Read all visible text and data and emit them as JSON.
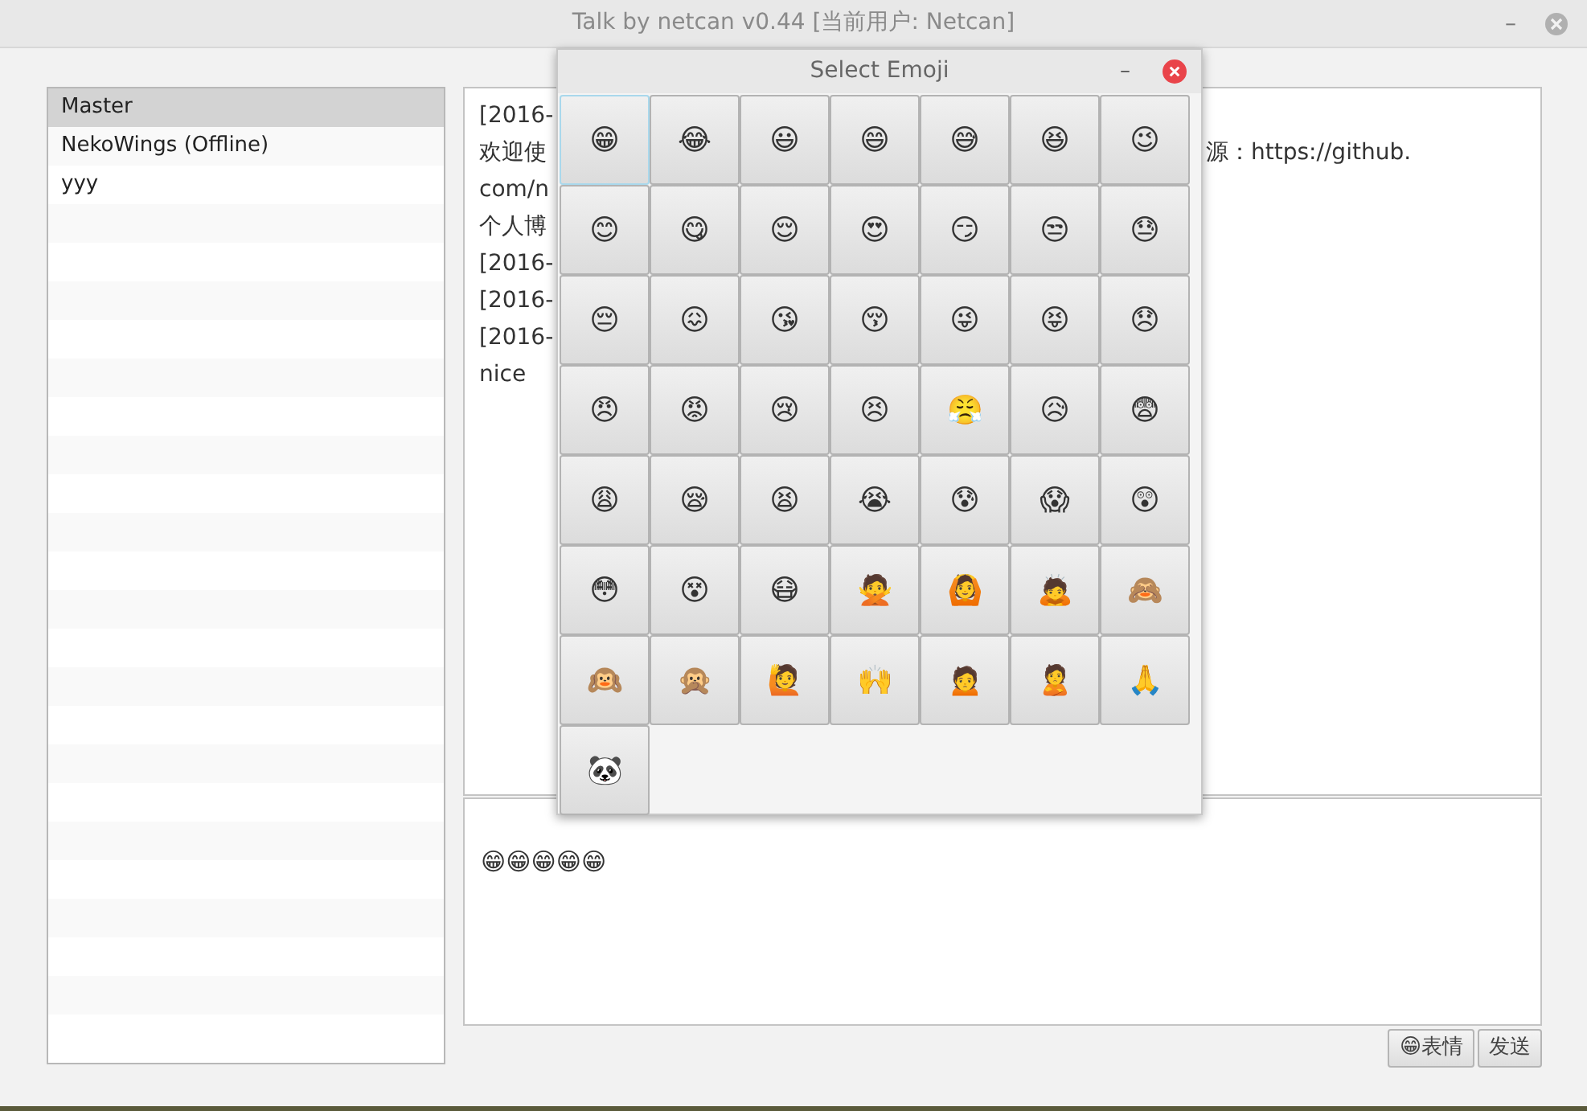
{
  "window": {
    "title": "Talk by netcan v0.44 [当前用户: Netcan]",
    "minimize": "–"
  },
  "contacts": [
    {
      "name": "Master",
      "selected": true
    },
    {
      "name": "NekoWings (Offline)",
      "selected": false
    },
    {
      "name": "yyy",
      "selected": false
    }
  ],
  "chat_log": [
    {
      "left": "[2016-"
    },
    {
      "left": "欢迎使",
      "right": "源：https://github."
    },
    {
      "left": "com/n"
    },
    {
      "left": "个人博"
    },
    {
      "left": "[2016-"
    },
    {
      "left": "[2016-"
    },
    {
      "left": "[2016-"
    },
    {
      "left": "nice"
    }
  ],
  "message_input": {
    "value": "😁😁😁😁😁"
  },
  "buttons": [
    {
      "label": "😁表情"
    },
    {
      "label": "发送"
    }
  ],
  "emoji_dialog": {
    "title": "Select Emoji",
    "minimize": "–",
    "emojis": [
      {
        "char": "😁",
        "focused": true
      },
      {
        "char": "😂",
        "focused": false
      },
      {
        "char": "😃",
        "focused": false
      },
      {
        "char": "😄",
        "focused": false
      },
      {
        "char": "😅",
        "focused": false
      },
      {
        "char": "😆",
        "focused": false
      },
      {
        "char": "😉",
        "focused": false
      },
      {
        "char": "😊",
        "focused": false
      },
      {
        "char": "😋",
        "focused": false
      },
      {
        "char": "😌",
        "focused": false
      },
      {
        "char": "😍",
        "focused": false
      },
      {
        "char": "😏",
        "focused": false
      },
      {
        "char": "😒",
        "focused": false
      },
      {
        "char": "😓",
        "focused": false
      },
      {
        "char": "😔",
        "focused": false
      },
      {
        "char": "😖",
        "focused": false
      },
      {
        "char": "😘",
        "focused": false
      },
      {
        "char": "😚",
        "focused": false
      },
      {
        "char": "😜",
        "focused": false
      },
      {
        "char": "😝",
        "focused": false
      },
      {
        "char": "😞",
        "focused": false
      },
      {
        "char": "😠",
        "focused": false
      },
      {
        "char": "😡",
        "focused": false
      },
      {
        "char": "😢",
        "focused": false
      },
      {
        "char": "😣",
        "focused": false
      },
      {
        "char": "😤",
        "focused": false
      },
      {
        "char": "😥",
        "focused": false
      },
      {
        "char": "😨",
        "focused": false
      },
      {
        "char": "😩",
        "focused": false
      },
      {
        "char": "😪",
        "focused": false
      },
      {
        "char": "😫",
        "focused": false
      },
      {
        "char": "😭",
        "focused": false
      },
      {
        "char": "😰",
        "focused": false
      },
      {
        "char": "😱",
        "focused": false
      },
      {
        "char": "😲",
        "focused": false
      },
      {
        "char": "😳",
        "focused": false
      },
      {
        "char": "😵",
        "focused": false
      },
      {
        "char": "😷",
        "focused": false
      },
      {
        "char": "🙅",
        "focused": false
      },
      {
        "char": "🙆",
        "focused": false
      },
      {
        "char": "🙇",
        "focused": false
      },
      {
        "char": "🙈",
        "focused": false
      },
      {
        "char": "🙉",
        "focused": false
      },
      {
        "char": "🙊",
        "focused": false
      },
      {
        "char": "🙋",
        "focused": false
      },
      {
        "char": "🙌",
        "focused": false
      },
      {
        "char": "🙍",
        "focused": false
      },
      {
        "char": "🙎",
        "focused": false
      },
      {
        "char": "🙏",
        "focused": false
      },
      {
        "char": "🐼",
        "focused": false
      }
    ]
  }
}
